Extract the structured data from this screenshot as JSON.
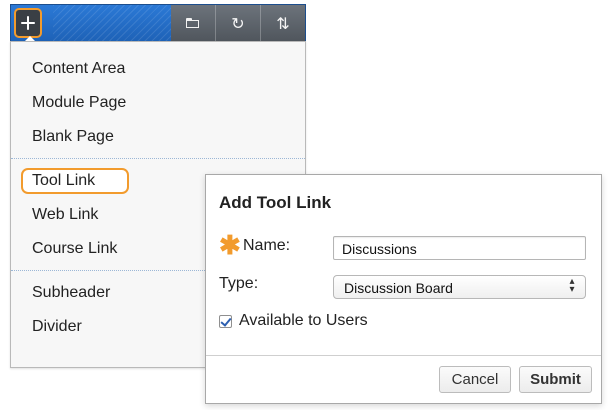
{
  "toolbar": {
    "add_icon": "plus-icon",
    "tools": [
      {
        "icon": "folder-icon",
        "symbol": ""
      },
      {
        "icon": "refresh-icon",
        "symbol": "↻"
      },
      {
        "icon": "sort-icon",
        "symbol": "⇅"
      }
    ]
  },
  "menu": {
    "items": [
      "Content Area",
      "Module Page",
      "Blank Page",
      "Tool Link",
      "Web Link",
      "Course Link",
      "Subheader",
      "Divider"
    ]
  },
  "dialog": {
    "title": "Add Tool Link",
    "required_marker": "✱",
    "name_label": "Name:",
    "name_value": "Discussions",
    "type_label": "Type:",
    "type_value": "Discussion Board",
    "available_label": "Available to Users",
    "cancel_label": "Cancel",
    "submit_label": "Submit"
  },
  "colors": {
    "toolbar_blue": "#2b79d6",
    "highlight_orange": "#f29b2d",
    "menu_bg": "#f7f7f7",
    "dialog_bg": "#ffffff"
  }
}
